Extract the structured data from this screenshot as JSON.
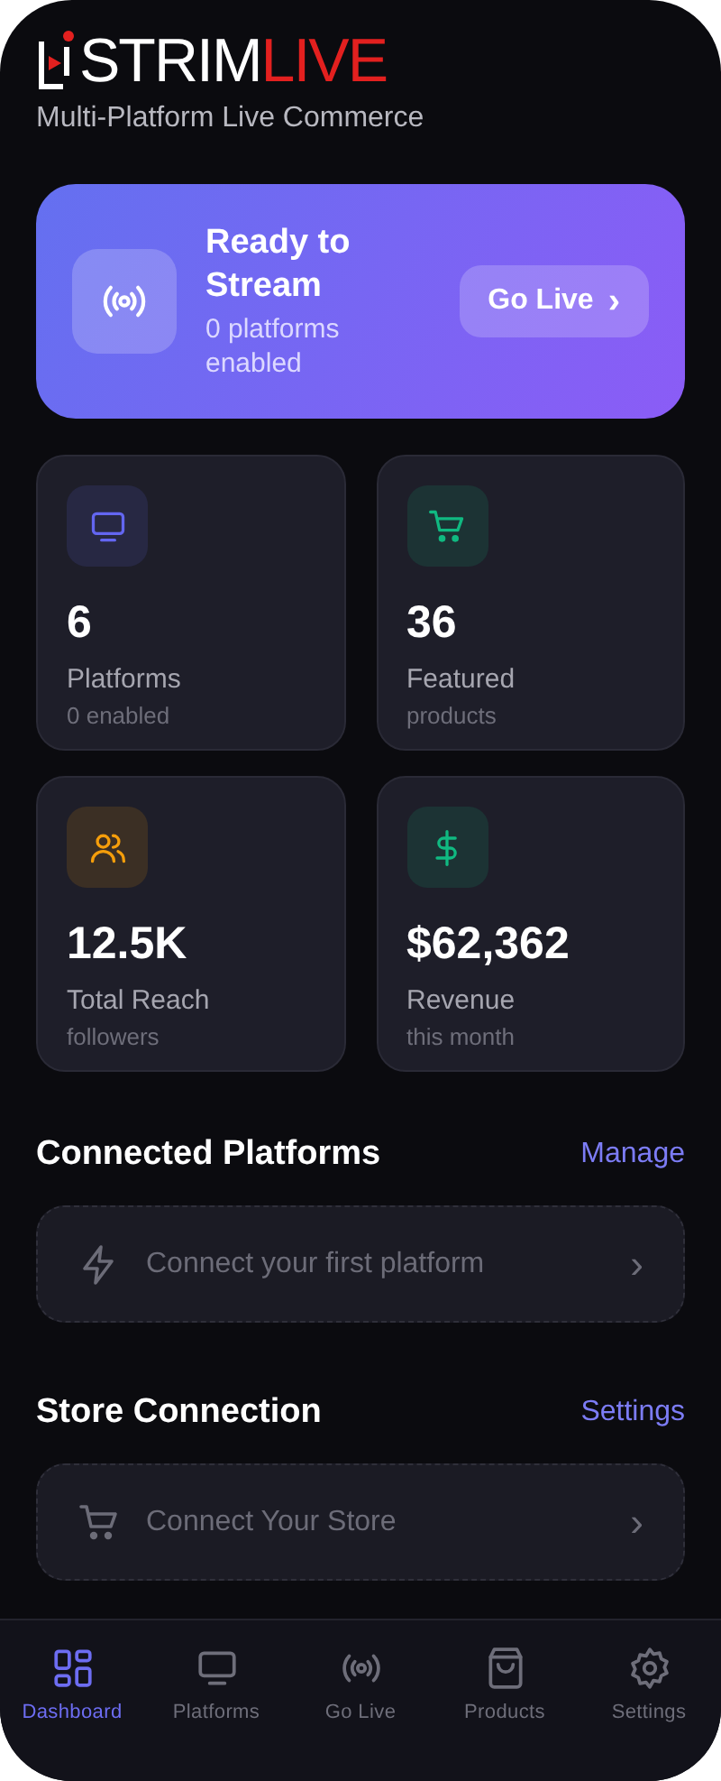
{
  "header": {
    "logo": {
      "brand": "STRIM",
      "accent": "LIVE"
    },
    "tagline": "Multi-Platform Live Commerce"
  },
  "banner": {
    "title": "Ready to Stream",
    "subtitle": "0 platforms enabled",
    "button": "Go Live",
    "chevron": "›"
  },
  "stats": [
    {
      "kind": "monitor",
      "color": "#6366f1",
      "value": "6",
      "label": "Platforms",
      "sublabel": "0 enabled"
    },
    {
      "kind": "cart",
      "color": "#10b981",
      "value": "36",
      "label": "Featured",
      "sublabel": "products"
    },
    {
      "kind": "users",
      "color": "#f59e0b",
      "value": "12.5K",
      "label": "Total Reach",
      "sublabel": "followers"
    },
    {
      "kind": "dollar",
      "color": "#10b981",
      "value": "$62,362",
      "label": "Revenue",
      "sublabel": "this month"
    }
  ],
  "sections": [
    {
      "title": "Connected Platforms",
      "action": "Manage",
      "empty": {
        "kind": "bolt",
        "text": "Connect your first platform",
        "chevron": "›"
      }
    },
    {
      "title": "Store Connection",
      "action": "Settings",
      "empty": {
        "kind": "cart",
        "text": "Connect Your Store",
        "chevron": "›"
      }
    }
  ],
  "nav": [
    {
      "kind": "grid",
      "label": "Dashboard",
      "selected": true
    },
    {
      "kind": "monitor",
      "label": "Platforms",
      "selected": false
    },
    {
      "kind": "radio",
      "label": "Go Live",
      "selected": false
    },
    {
      "kind": "bag",
      "label": "Products",
      "selected": false
    },
    {
      "kind": "gear",
      "label": "Settings",
      "selected": false
    }
  ]
}
